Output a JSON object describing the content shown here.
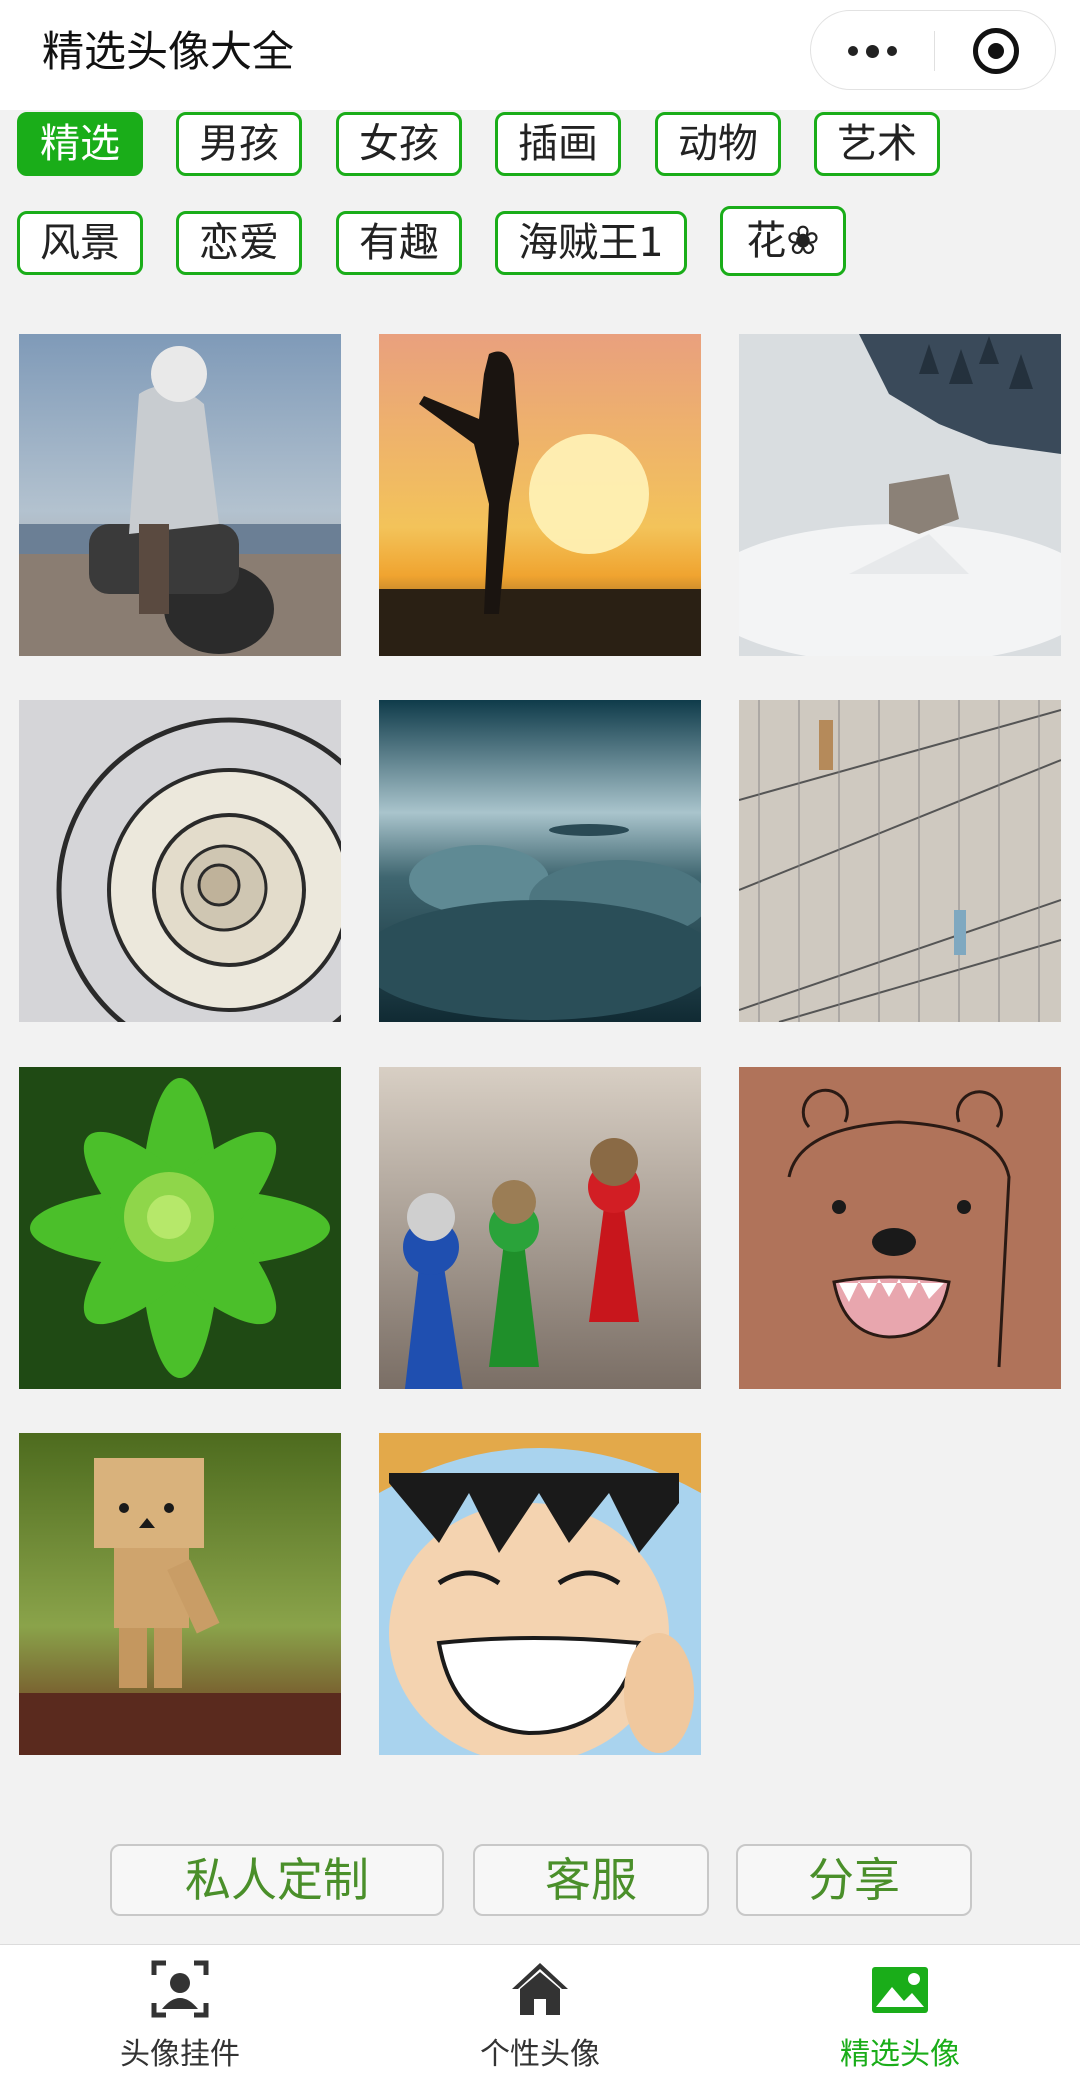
{
  "header": {
    "title": "精选头像大全",
    "more_icon": "more-dots-icon",
    "close_icon": "target-close-icon"
  },
  "tags": [
    {
      "label": "精选",
      "active": true
    },
    {
      "label": "男孩",
      "active": false
    },
    {
      "label": "女孩",
      "active": false
    },
    {
      "label": "插画",
      "active": false
    },
    {
      "label": "动物",
      "active": false
    },
    {
      "label": "艺术",
      "active": false
    },
    {
      "label": "风景",
      "active": false
    },
    {
      "label": "恋爱",
      "active": false
    },
    {
      "label": "有趣",
      "active": false
    },
    {
      "label": "海贼王1",
      "active": false
    },
    {
      "label": "花❀",
      "active": false
    }
  ],
  "gallery": [
    {
      "name": "motorcycle-rider-thumb"
    },
    {
      "name": "sunset-silhouette-thumb"
    },
    {
      "name": "wolves-in-fog-thumb"
    },
    {
      "name": "spiral-staircase-thumb"
    },
    {
      "name": "cloudy-sky-thumb"
    },
    {
      "name": "stairs-couple-thumb"
    },
    {
      "name": "green-plant-thumb"
    },
    {
      "name": "game-pieces-thumb"
    },
    {
      "name": "brown-bear-cartoon-thumb"
    },
    {
      "name": "box-robot-thumb"
    },
    {
      "name": "luffy-smile-thumb"
    }
  ],
  "actions": {
    "custom_label": "私人定制",
    "service_label": "客服",
    "share_label": "分享"
  },
  "tabbar": {
    "items": [
      {
        "label": "头像挂件",
        "icon": "portrait-frame-icon",
        "active": false
      },
      {
        "label": "个性头像",
        "icon": "home-icon",
        "active": false
      },
      {
        "label": "精选头像",
        "icon": "image-icon",
        "active": true
      }
    ]
  },
  "colors": {
    "accent": "#1aad19",
    "button_text": "#4a8f2a",
    "background": "#f2f2f2"
  }
}
